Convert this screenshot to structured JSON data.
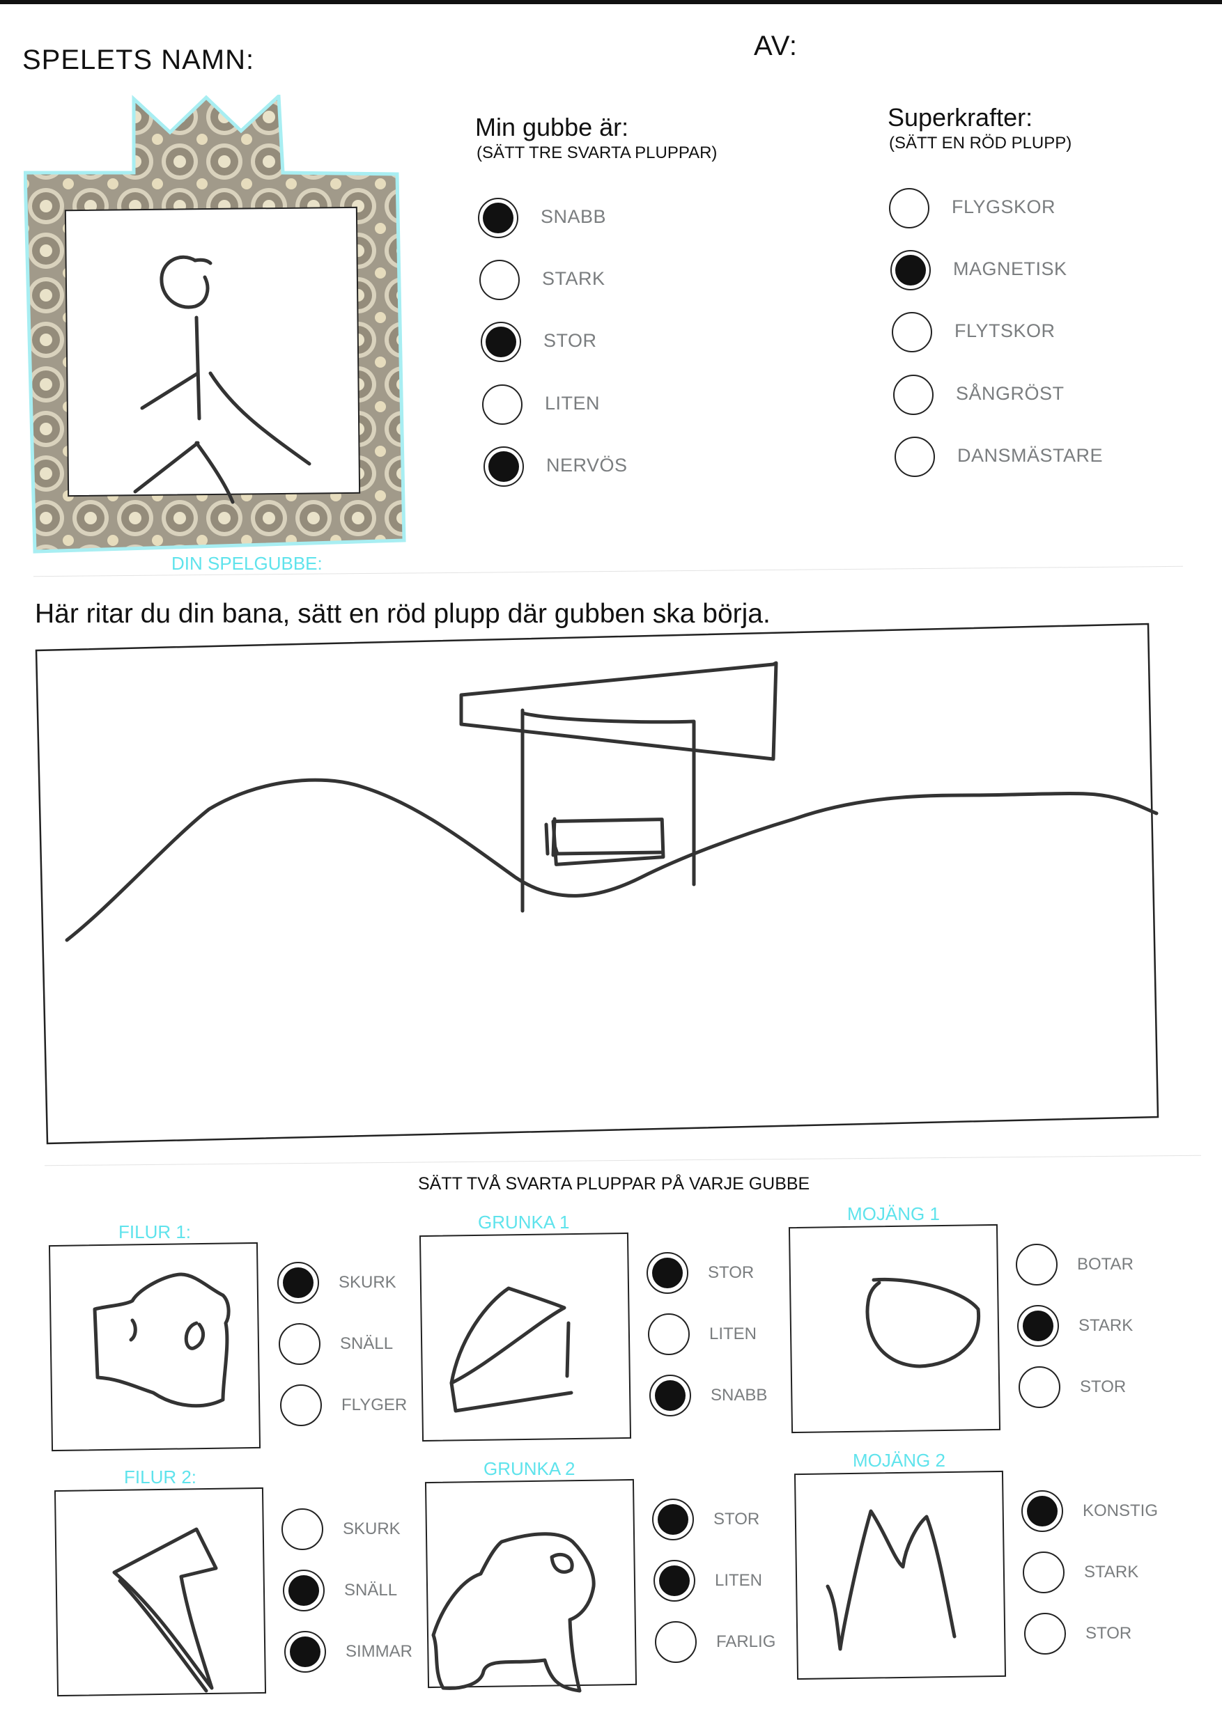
{
  "header": {
    "game_name_label": "SPELETS NAMN:",
    "author_label": "AV:"
  },
  "character": {
    "caption": "DIN SPELGUBBE:"
  },
  "traits": {
    "title": "Min gubbe är:",
    "instruction": "(SÄTT TRE SVARTA PLUPPAR)",
    "options": [
      {
        "label": "SNABB",
        "filled": true
      },
      {
        "label": "STARK",
        "filled": false
      },
      {
        "label": "STOR",
        "filled": true
      },
      {
        "label": "LITEN",
        "filled": false
      },
      {
        "label": "NERVÖS",
        "filled": true
      }
    ]
  },
  "powers": {
    "title": "Superkrafter:",
    "instruction": "(SÄTT EN RÖD PLUPP)",
    "options": [
      {
        "label": "FLYGSKOR",
        "filled": false
      },
      {
        "label": "MAGNETISK",
        "filled": true
      },
      {
        "label": "FLYTSKOR",
        "filled": false
      },
      {
        "label": "SÅNGRÖST",
        "filled": false
      },
      {
        "label": "DANSMÄSTARE",
        "filled": false
      }
    ]
  },
  "level": {
    "instruction": "Här ritar du din bana, sätt en röd plupp där gubben ska börja."
  },
  "figures": {
    "instruction": "SÄTT TVÅ SVARTA PLUPPAR PÅ VARJE GUBBE",
    "cards": [
      {
        "title": "FILUR 1:",
        "options": [
          {
            "label": "SKURK",
            "filled": true
          },
          {
            "label": "SNÄLL",
            "filled": false
          },
          {
            "label": "FLYGER",
            "filled": false
          }
        ]
      },
      {
        "title": "GRUNKA 1",
        "options": [
          {
            "label": "STOR",
            "filled": true
          },
          {
            "label": "LITEN",
            "filled": false
          },
          {
            "label": "SNABB",
            "filled": true
          }
        ]
      },
      {
        "title": "MOJÄNG 1",
        "options": [
          {
            "label": "BOTAR",
            "filled": false
          },
          {
            "label": "STARK",
            "filled": true
          },
          {
            "label": "STOR",
            "filled": false
          }
        ]
      },
      {
        "title": "FILUR 2:",
        "options": [
          {
            "label": "SKURK",
            "filled": false
          },
          {
            "label": "SNÄLL",
            "filled": true
          },
          {
            "label": "SIMMAR",
            "filled": true
          }
        ]
      },
      {
        "title": "GRUNKA 2",
        "options": [
          {
            "label": "STOR",
            "filled": true
          },
          {
            "label": "LITEN",
            "filled": true
          },
          {
            "label": "FARLIG",
            "filled": false
          }
        ]
      },
      {
        "title": "MOJÄNG 2",
        "options": [
          {
            "label": "KONSTIG",
            "filled": true
          },
          {
            "label": "STARK",
            "filled": false
          },
          {
            "label": "STOR",
            "filled": false
          }
        ]
      }
    ]
  }
}
